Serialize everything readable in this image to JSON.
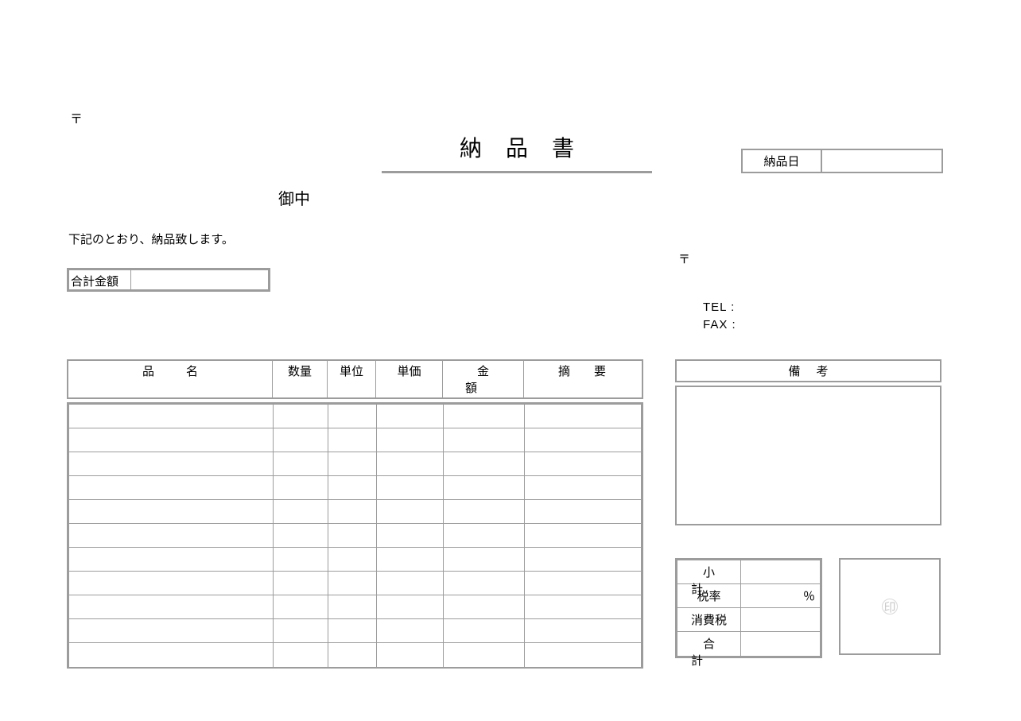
{
  "postal_mark": "〒",
  "title": "納品書",
  "delivery_date_label": "納品日",
  "delivery_date_value": "",
  "onchuu": "御中",
  "intro": "下記のとおり、納品致します。",
  "vendor_postal_mark": "〒",
  "tel_label": "TEL :",
  "fax_label": "FAX :",
  "total_label": "合計金額",
  "total_value": "",
  "items": {
    "headers": {
      "name": "品名",
      "qty": "数量",
      "unit": "単位",
      "price": "単価",
      "amount": "金額",
      "note": "摘要"
    },
    "row_count": 11
  },
  "remarks_label": "備考",
  "summary": {
    "subtotal_label": "小計",
    "subtotal_value": "",
    "taxrate_label": "税率",
    "taxrate_value": "％",
    "tax_label": "消費税",
    "tax_value": "",
    "total_label": "合計",
    "total_value": ""
  },
  "seal_char": "印"
}
